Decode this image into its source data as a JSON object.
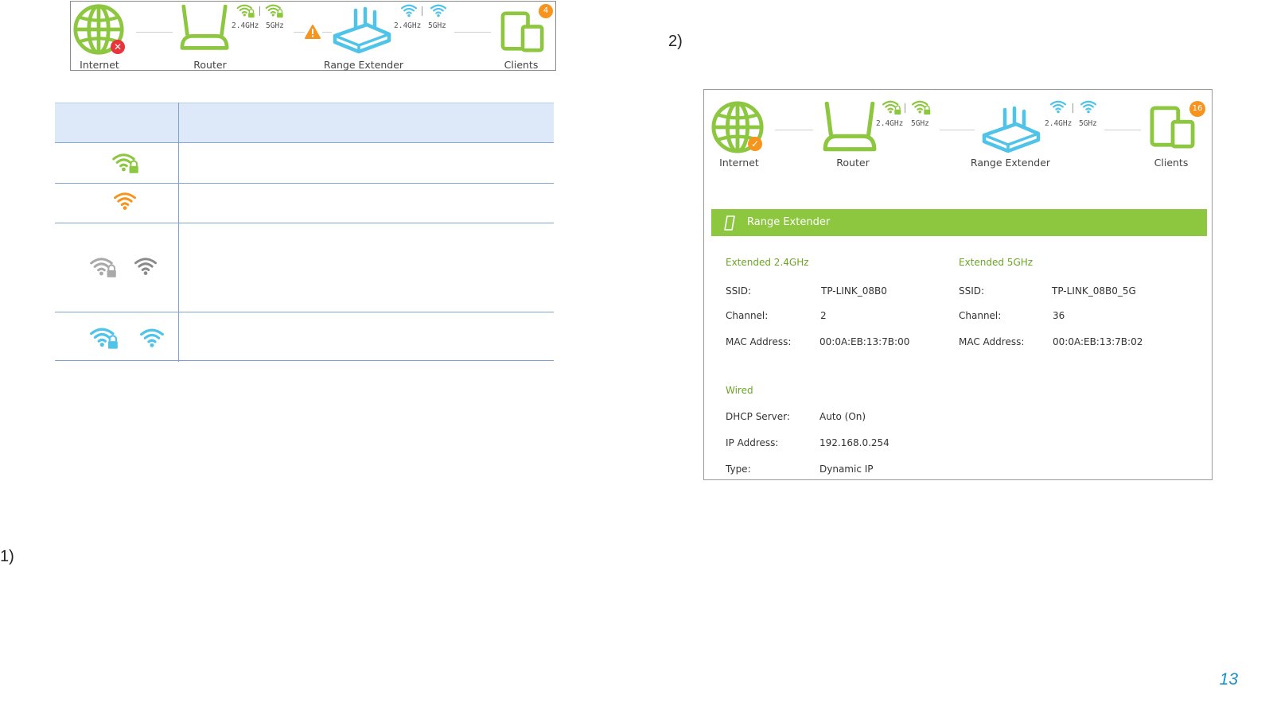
{
  "topology1": {
    "internet_label": "Internet",
    "router_label": "Router",
    "extender_label": "Range Extender",
    "clients_label": "Clients",
    "router_freq_24": "2.4GHz",
    "router_freq_5": "5GHz",
    "extender_freq_24": "2.4GHz",
    "extender_freq_5": "5GHz",
    "clients_count": "4"
  },
  "step_labels": {
    "step1": "1)",
    "step2": "2)"
  },
  "legend_table": {
    "rows": [
      {
        "icons": [
          "wifi-locked-green-icon"
        ]
      },
      {
        "icons": [
          "wifi-orange-icon"
        ]
      },
      {
        "icons": [
          "wifi-locked-gray-icon",
          "wifi-gray-icon"
        ]
      },
      {
        "icons": [
          "wifi-locked-blue-icon",
          "wifi-blue-icon"
        ]
      }
    ]
  },
  "topology2": {
    "internet_label": "Internet",
    "router_label": "Router",
    "extender_label": "Range Extender",
    "clients_label": "Clients",
    "router_freq_24": "2.4GHz",
    "router_freq_5": "5GHz",
    "extender_freq_24": "2.4GHz",
    "extender_freq_5": "5GHz",
    "clients_count": "16"
  },
  "range_extender_panel": {
    "title": "Range Extender",
    "ext24": {
      "heading": "Extended 2.4GHz",
      "ssid_label": "SSID:",
      "ssid": "TP-LINK_08B0",
      "channel_label": "Channel:",
      "channel": "2",
      "mac_label": "MAC Address:",
      "mac": "00:0A:EB:13:7B:00"
    },
    "ext5": {
      "heading": "Extended 5GHz",
      "ssid_label": "SSID:",
      "ssid": "TP-LINK_08B0_5G",
      "channel_label": "Channel:",
      "channel": "36",
      "mac_label": "MAC Address:",
      "mac": "00:0A:EB:13:7B:02"
    },
    "wired": {
      "heading": "Wired",
      "dhcp_label": "DHCP Server:",
      "dhcp": "Auto (On)",
      "ip_label": "IP Address:",
      "ip": "192.168.0.254",
      "type_label": "Type:",
      "type": "Dynamic IP"
    }
  },
  "page_number": "13",
  "colors": {
    "green": "#8dc63f",
    "orange": "#f7941d",
    "blue": "#4fc3e8",
    "gray": "#9a9a9a",
    "error_red": "#e8343a",
    "page_number_blue": "#1a8fc9"
  }
}
